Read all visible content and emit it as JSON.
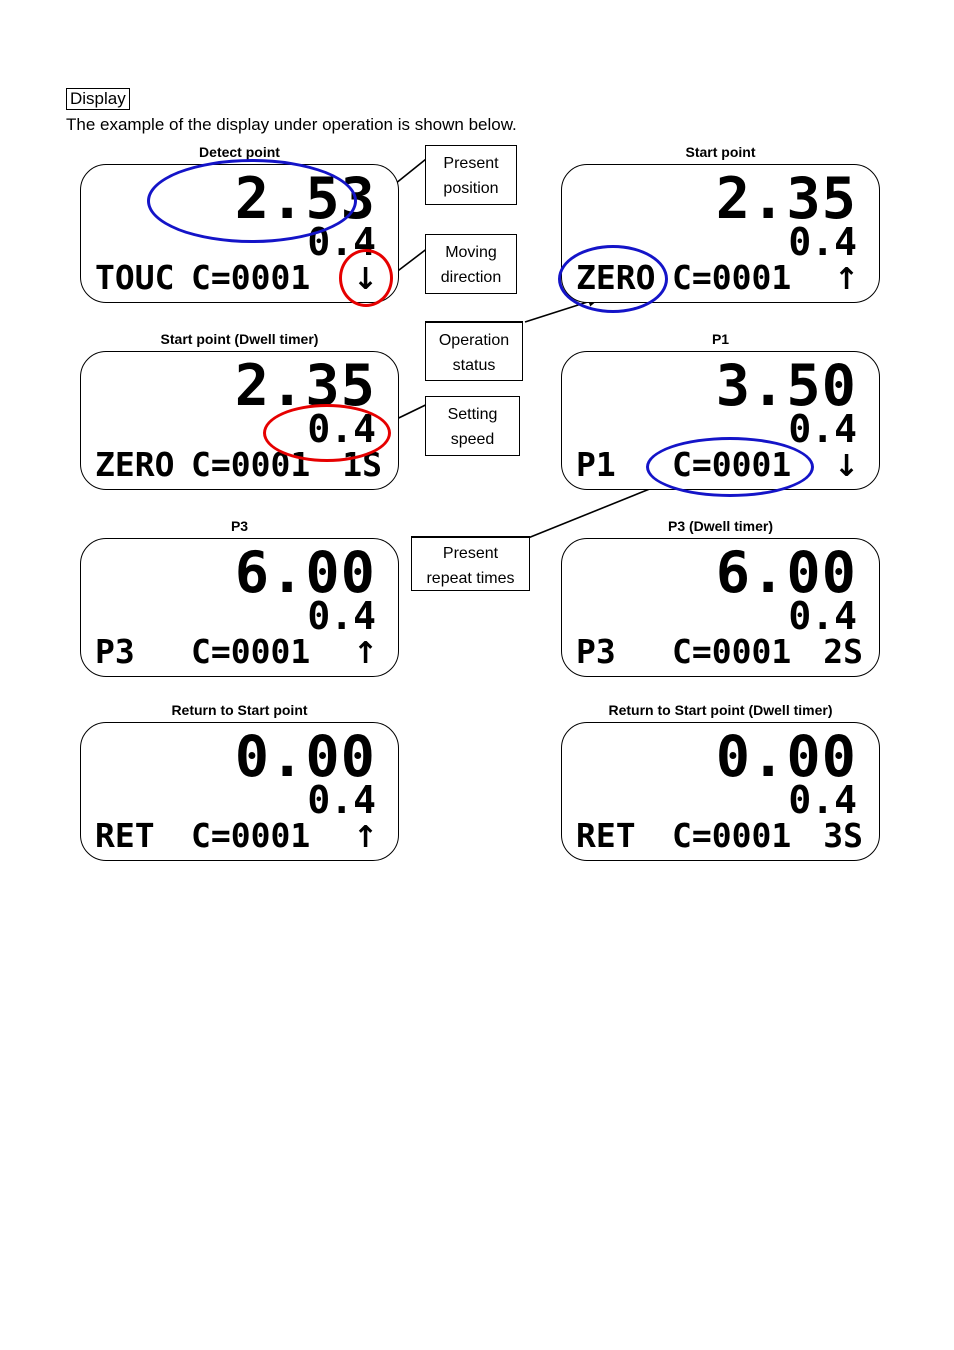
{
  "header": {
    "tag": "Display",
    "intro": "The example of the display under operation is shown below."
  },
  "panels": [
    {
      "caption": "Detect point",
      "position": "2.53",
      "speed": "0.4",
      "status": "TOUC",
      "count": "C=0001",
      "timer": "",
      "arrow": "↓",
      "arrow_name": "down-arrow-icon"
    },
    {
      "caption": "Start point",
      "position": "2.35",
      "speed": "0.4",
      "status": "ZERO",
      "count": "C=0001",
      "timer": "",
      "arrow": "↑",
      "arrow_name": "up-arrow-icon"
    },
    {
      "caption": "Start point (Dwell timer)",
      "position": "2.35",
      "speed": "0.4",
      "status": "ZERO",
      "count": "C=0001",
      "timer": "1S",
      "arrow": "",
      "arrow_name": "no-arrow-icon"
    },
    {
      "caption": "P1",
      "position": "3.50",
      "speed": "0.4",
      "status": "P1",
      "count": "C=0001",
      "timer": "",
      "arrow": "↓",
      "arrow_name": "down-arrow-icon"
    },
    {
      "caption": "P3",
      "position": "6.00",
      "speed": "0.4",
      "status": "P3",
      "count": "C=0001",
      "timer": "",
      "arrow": "↑",
      "arrow_name": "up-arrow-icon"
    },
    {
      "caption": "P3 (Dwell timer)",
      "position": "6.00",
      "speed": "0.4",
      "status": "P3",
      "count": "C=0001",
      "timer": "2S",
      "arrow": "",
      "arrow_name": "no-arrow-icon"
    },
    {
      "caption": "Return to Start point",
      "position": "0.00",
      "speed": "0.4",
      "status": "RET",
      "count": "C=0001",
      "timer": "",
      "arrow": "↑",
      "arrow_name": "up-arrow-icon"
    },
    {
      "caption": "Return to Start point (Dwell timer)",
      "position": "0.00",
      "speed": "0.4",
      "status": "RET",
      "count": "C=0001",
      "timer": "3S",
      "arrow": "",
      "arrow_name": "no-arrow-icon"
    }
  ],
  "callouts": [
    {
      "line1": "Present",
      "line2": "position"
    },
    {
      "line1": "Moving",
      "line2": "direction"
    },
    {
      "line1": "Operation",
      "line2": "status"
    },
    {
      "line1": "Setting",
      "line2": "speed"
    },
    {
      "line1": "Present",
      "line2": "repeat times"
    }
  ],
  "colors": {
    "highlight_blue": "#1414c8",
    "highlight_red": "#e60000",
    "text": "#000000",
    "background": "#ffffff"
  }
}
